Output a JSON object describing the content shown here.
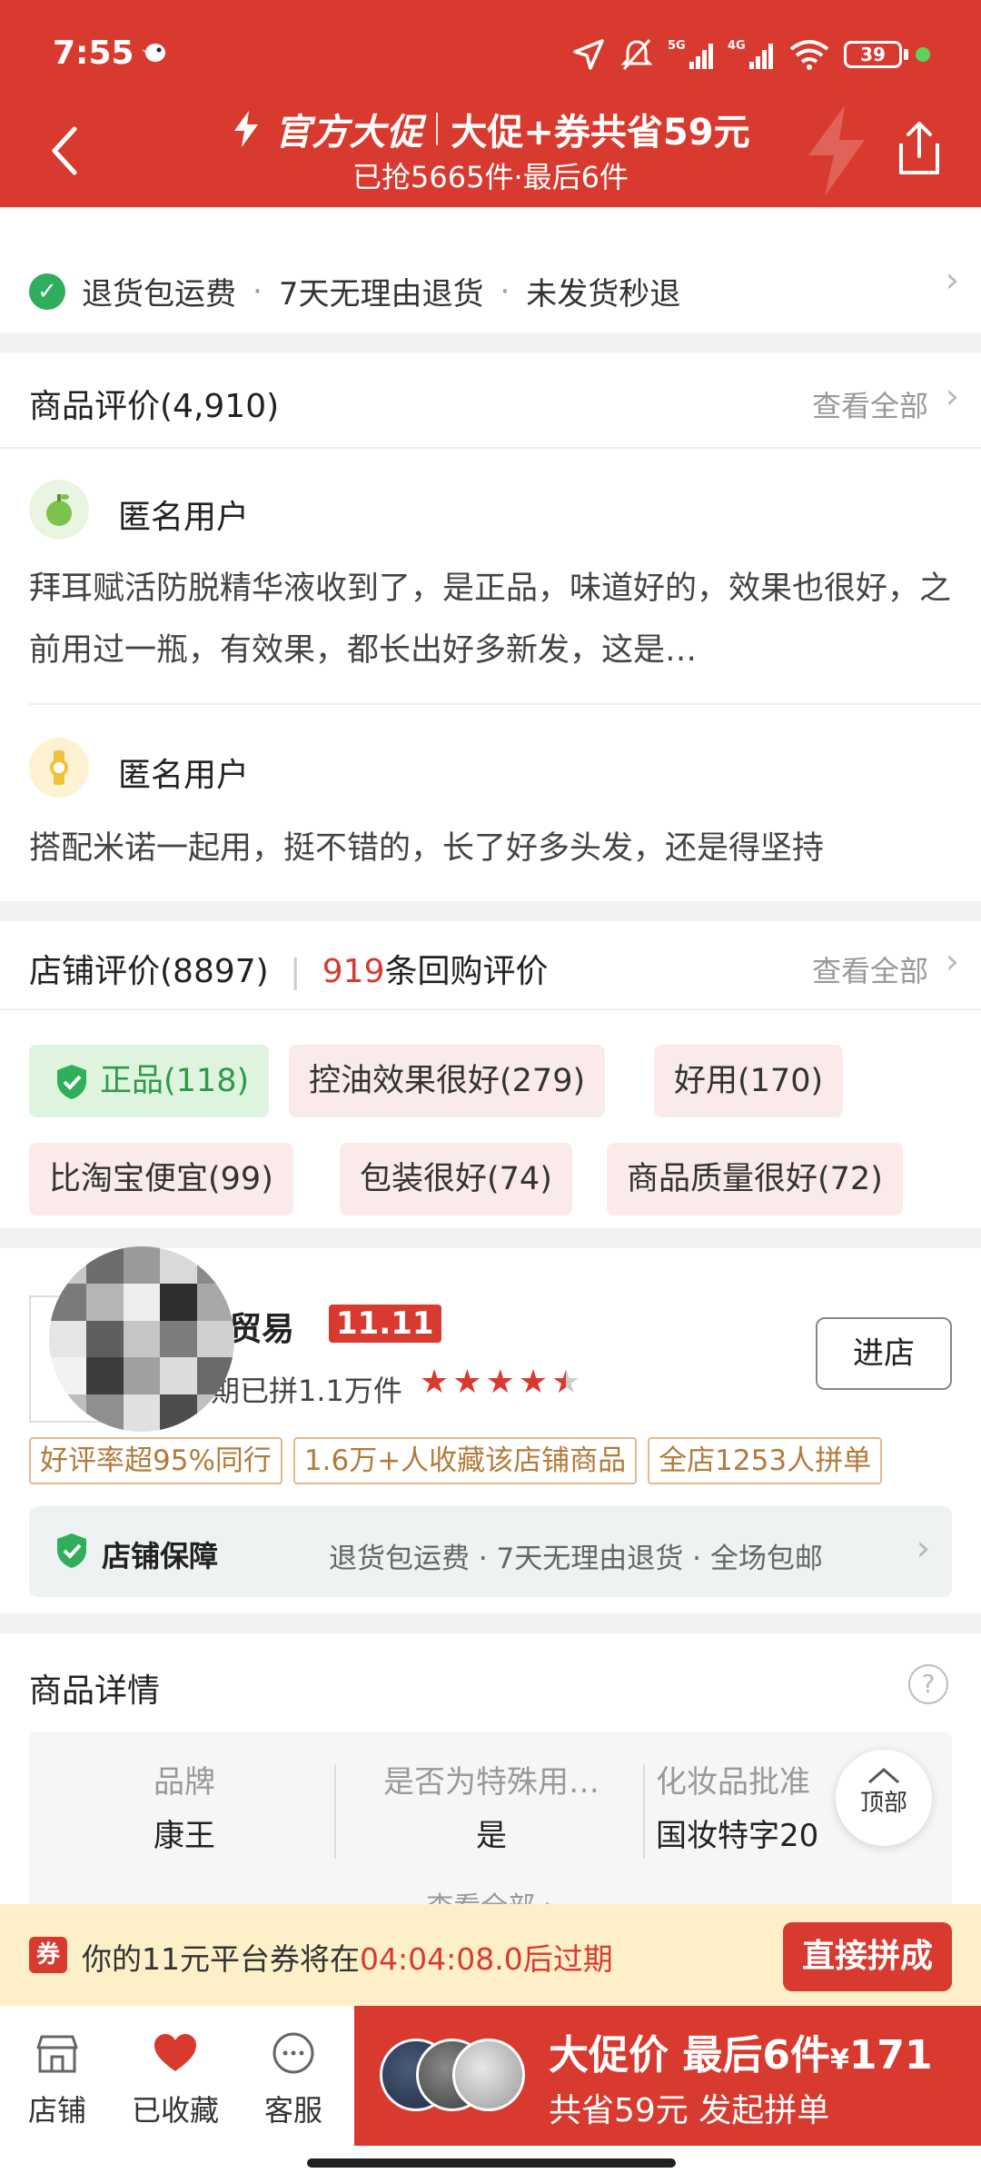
{
  "status_bar": {
    "time": "7:55",
    "battery": "39"
  },
  "header": {
    "promo_name": "官方大促",
    "promo_saving": "大促+券共省59元",
    "subtitle": "已抢5665件·最后6件"
  },
  "guarantees": {
    "items": [
      "退货包运费",
      "7天无理由退货",
      "未发货秒退"
    ],
    "dot": "·"
  },
  "reviews": {
    "title": "商品评价(4,910)",
    "see_all": "查看全部",
    "items": [
      {
        "user": "匿名用户",
        "text": "拜耳赋活防脱精华液收到了，是正品，味道好的，效果也很好，之前用过一瓶，有效果，都长出好多新发，这是…",
        "avatar_color": "#7dc24b"
      },
      {
        "user": "匿名用户",
        "text": "搭配米诺一起用，挺不错的，长了好多头发，还是得坚持",
        "avatar_color": "#f0c23a"
      }
    ]
  },
  "shop_reviews": {
    "title": "店铺评价(8897)",
    "repurchase_count": "919",
    "repurchase_label": "条回购评价",
    "see_all": "查看全部",
    "tags": [
      "正品(118)",
      "控油效果很好(279)",
      "好用(170)",
      "比淘宝便宜(99)",
      "包装很好(74)",
      "商品质量很好(72)"
    ]
  },
  "store": {
    "name": "贸易",
    "badge": "11.11",
    "sold": "期已拼1.1万件",
    "rating": 4.5,
    "enter": "进店",
    "chips": [
      "好评率超95%同行",
      "1.6万+人收藏该店铺商品",
      "全店1253人拼单"
    ],
    "assurance_title": "店铺保障",
    "assurance_text": "退货包运费 · 7天无理由退货 · 全场包邮"
  },
  "details": {
    "title": "商品详情",
    "help": "?",
    "attrs": [
      {
        "label": "品牌",
        "value": "康王"
      },
      {
        "label": "是否为特殊用…",
        "value": "是"
      },
      {
        "label": "化妆品批准",
        "value": "国妆特字20"
      }
    ],
    "more": "查看全部 ›",
    "top_label": "顶部"
  },
  "coupon": {
    "icon": "券",
    "prefix": "你的11元平台券将在",
    "countdown": "04:04:08.0后过期",
    "button": "直接拼成"
  },
  "bottom_nav": {
    "items": [
      {
        "label": "店铺",
        "icon": "store-icon"
      },
      {
        "label": "已收藏",
        "icon": "heart-icon"
      },
      {
        "label": "客服",
        "icon": "chat-icon"
      }
    ]
  },
  "buy": {
    "main": "大促价 最后6件",
    "currency": "¥",
    "price": "171",
    "sub": "共省59元 发起拼单"
  },
  "colors": {
    "brand_red": "#d93a2f",
    "green": "#2fae5b"
  }
}
